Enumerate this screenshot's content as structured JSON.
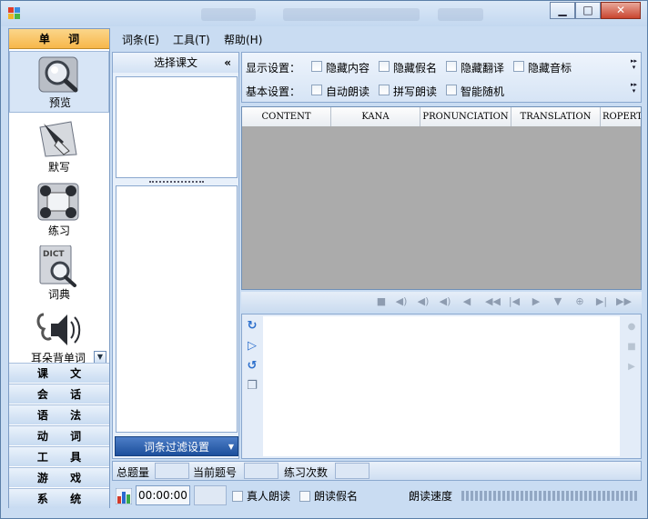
{
  "window": {
    "title": ""
  },
  "menu": [
    "词条(E)",
    "工具(T)",
    "帮助(H)"
  ],
  "leftnav": {
    "header": "单 词",
    "tools": [
      {
        "label": "预览",
        "icon": "magnifier-icon",
        "selected": true
      },
      {
        "label": "默写",
        "icon": "pen-nib-icon",
        "selected": false
      },
      {
        "label": "练习",
        "icon": "practice-icon",
        "selected": false
      },
      {
        "label": "词典",
        "icon": "dictionary-icon",
        "selected": false
      },
      {
        "label": "耳朵背单词",
        "icon": "ear-speaker-icon",
        "selected": false
      }
    ],
    "categories": [
      "课 文",
      "会 话",
      "语 法",
      "动 词",
      "工 具",
      "游 戏",
      "系 统"
    ]
  },
  "lesson_panel": {
    "title": "选择课文",
    "collapse": "«",
    "filter_button": "词条过滤设置"
  },
  "display_settings": {
    "label": "显示设置：",
    "options": [
      "隐藏内容",
      "隐藏假名",
      "隐藏翻译",
      "隐藏音标"
    ]
  },
  "basic_settings": {
    "label": "基本设置：",
    "options": [
      "自动朗读",
      "拼写朗读",
      "智能随机"
    ]
  },
  "grid": {
    "columns": [
      "CONTENT",
      "KANA",
      "PRONUNCIATION",
      "TRANSLATION",
      "ROPERTY"
    ]
  },
  "stats": {
    "total_label": "总题量",
    "current_label": "当前题号",
    "practice_label": "练习次数"
  },
  "bottom": {
    "time": "00:00:00",
    "real_voice": "真人朗读",
    "read_kana": "朗读假名",
    "speed_label": "朗读速度"
  }
}
